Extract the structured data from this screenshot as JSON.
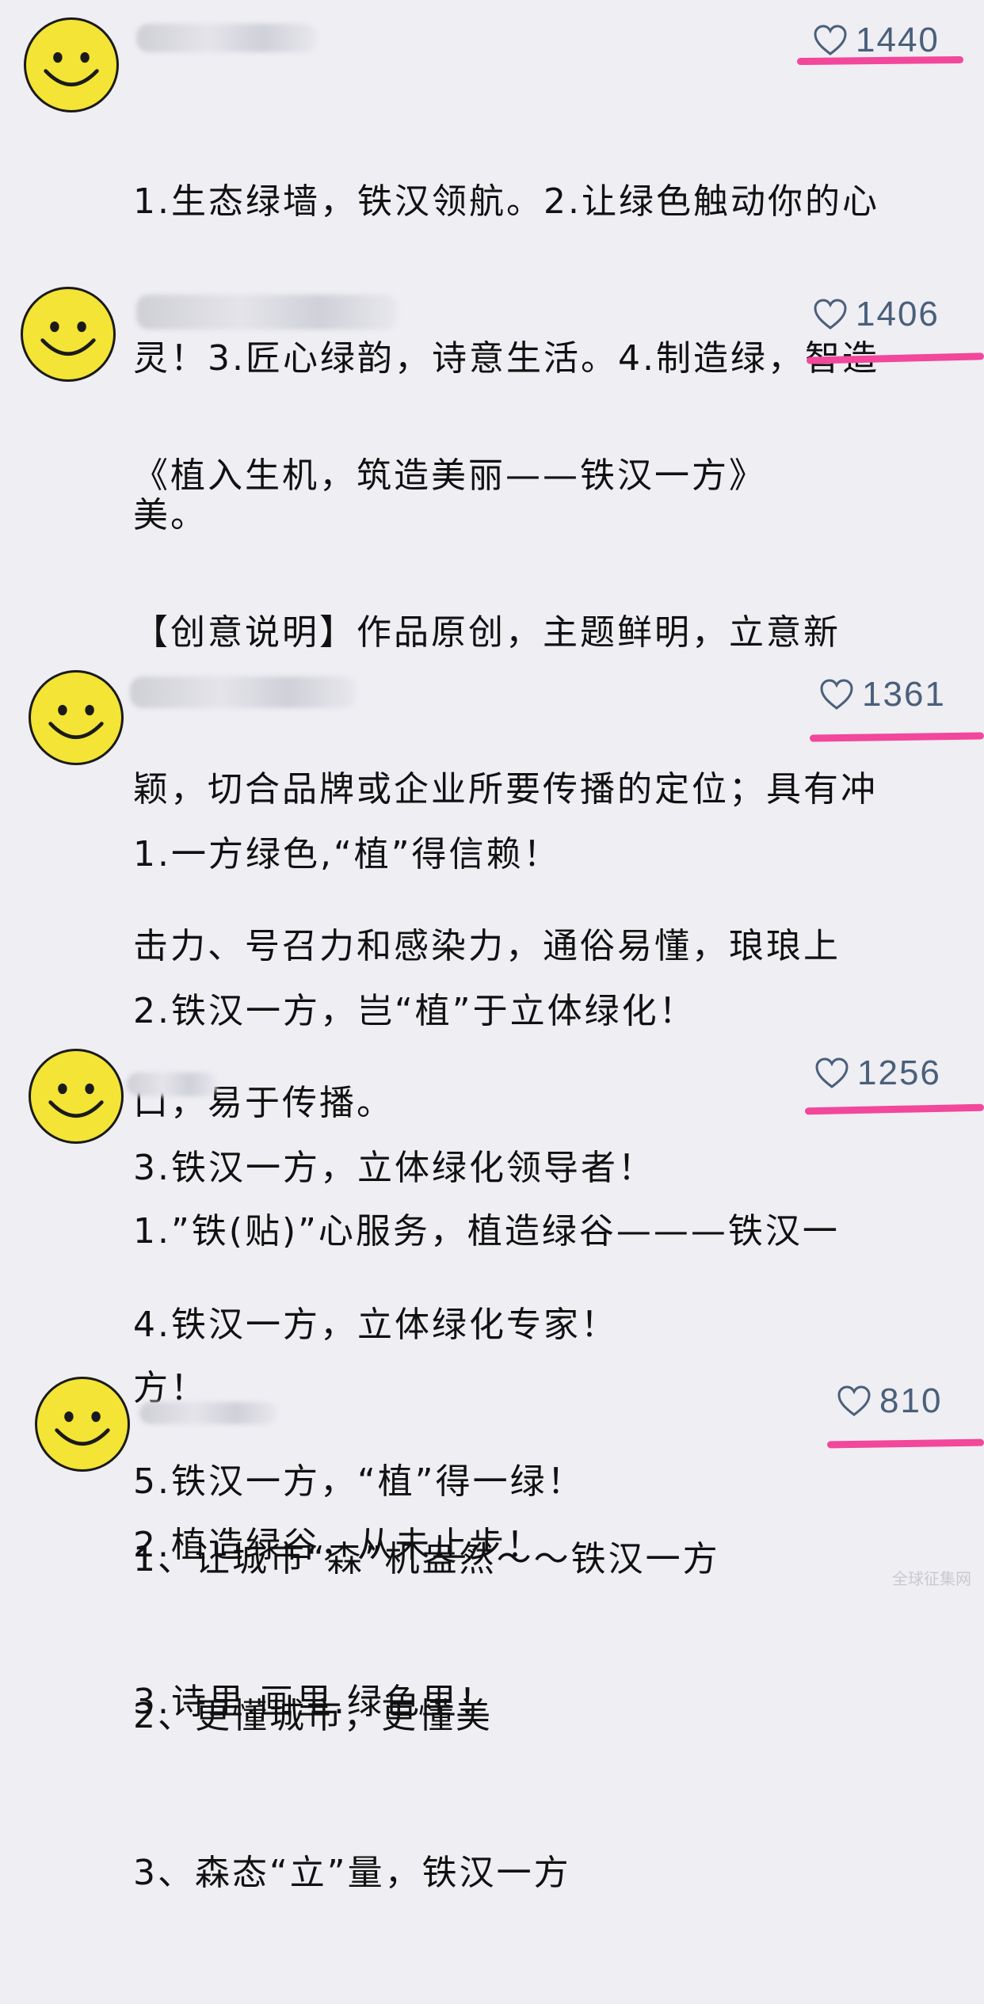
{
  "comments": [
    {
      "likes": "1440",
      "lines": [
        "1.生态绿墙，铁汉领航。2.让绿色触动你的心",
        "灵！3.匠心绿韵，诗意生活。4.制造绿，智造",
        "美。"
      ]
    },
    {
      "likes": "1406",
      "lines": [
        "《植入生机，筑造美丽——铁汉一方》",
        "【创意说明】作品原创，主题鲜明，立意新",
        "颖，切合品牌或企业所要传播的定位；具有冲",
        "击力、号召力和感染力，通俗易懂，琅琅上",
        "口，易于传播。"
      ]
    },
    {
      "likes": "1361",
      "lines": [
        "1.一方绿色,“植”得信赖！",
        "2.铁汉一方，岂“植”于立体绿化！",
        "3.铁汉一方，立体绿化领导者！",
        "4.铁汉一方，立体绿化专家！",
        "5.铁汉一方，“植”得一绿！"
      ]
    },
    {
      "likes": "1256",
      "lines": [
        "1.”铁(贴)”心服务，植造绿谷———铁汉一",
        "方！",
        "2.植造绿谷，从未止步！",
        "3.诗里.画里.绿色里！"
      ]
    },
    {
      "likes": "810",
      "lines": [
        "1、让城市“森”机盎然～～铁汉一方",
        "2、更懂城市，更懂美",
        "3、森态“立”量，铁汉一方"
      ]
    }
  ],
  "icons": {
    "like": "heart-outline-icon",
    "avatar": "smiley-face-icon"
  },
  "colors": {
    "background": "#eeeef3",
    "like_text": "#4a5f7a",
    "highlight_underline": "#f2479b",
    "avatar_fill": "#f3e436"
  },
  "watermark": "全球征集网"
}
